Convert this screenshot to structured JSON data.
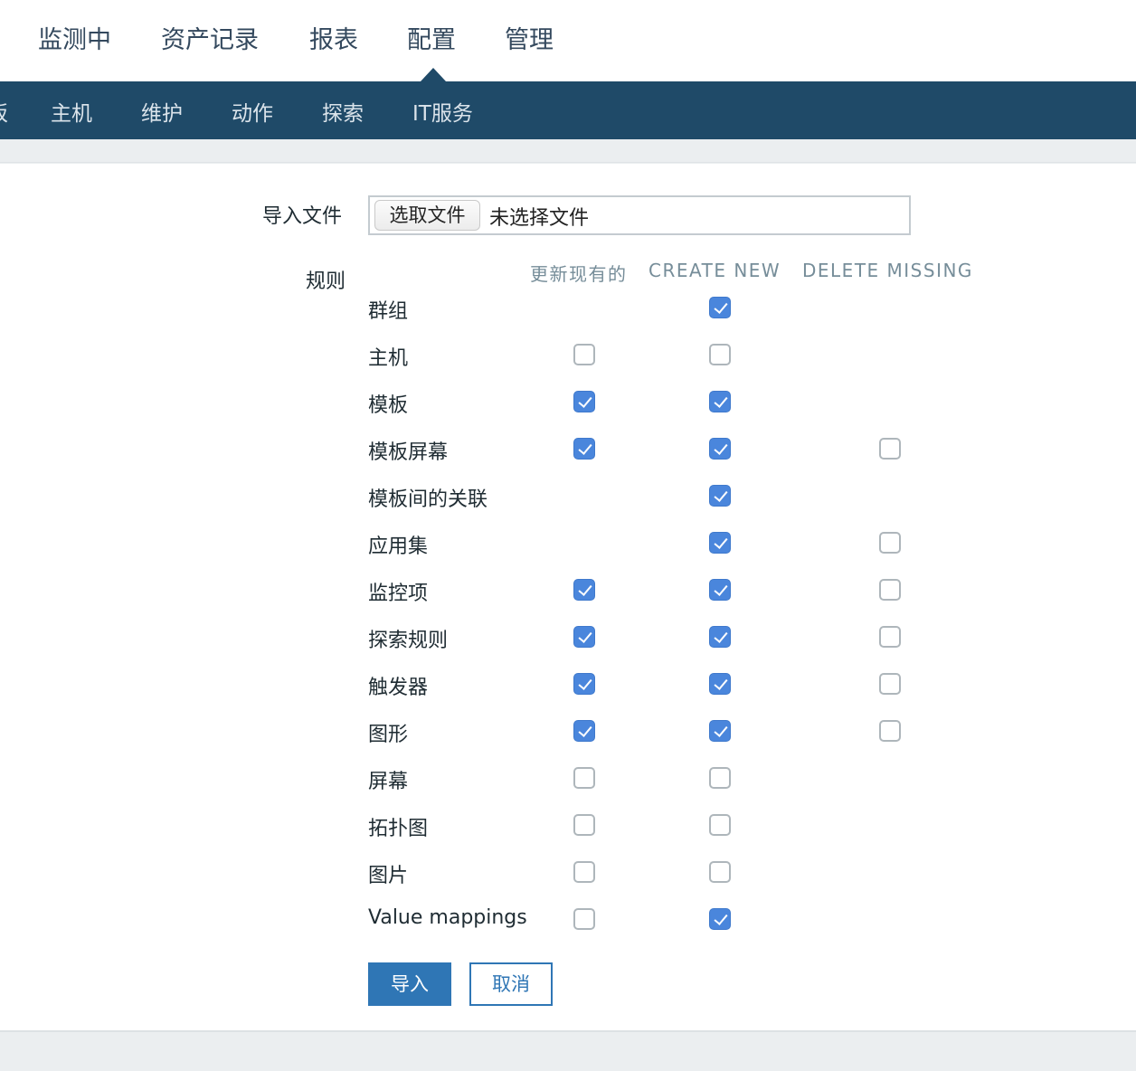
{
  "top_nav": {
    "items": [
      "监测中",
      "资产记录",
      "报表",
      "配置",
      "管理"
    ],
    "active": "配置"
  },
  "sub_nav": {
    "items": [
      "板",
      "主机",
      "维护",
      "动作",
      "探索",
      "IT服务"
    ]
  },
  "form": {
    "import_file_label": "导入文件",
    "choose_file_button": "选取文件",
    "no_file_text": "未选择文件",
    "rules_label": "规则",
    "columns": [
      "更新现有的",
      "CREATE NEW",
      "DELETE MISSING"
    ],
    "rules": [
      {
        "name": "群组",
        "update": null,
        "create": true,
        "delete": null
      },
      {
        "name": "主机",
        "update": false,
        "create": false,
        "delete": null
      },
      {
        "name": "模板",
        "update": true,
        "create": true,
        "delete": null
      },
      {
        "name": "模板屏幕",
        "update": true,
        "create": true,
        "delete": false
      },
      {
        "name": "模板间的关联",
        "update": null,
        "create": true,
        "delete": null
      },
      {
        "name": "应用集",
        "update": null,
        "create": true,
        "delete": false
      },
      {
        "name": "监控项",
        "update": true,
        "create": true,
        "delete": false
      },
      {
        "name": "探索规则",
        "update": true,
        "create": true,
        "delete": false
      },
      {
        "name": "触发器",
        "update": true,
        "create": true,
        "delete": false
      },
      {
        "name": "图形",
        "update": true,
        "create": true,
        "delete": false
      },
      {
        "name": "屏幕",
        "update": false,
        "create": false,
        "delete": null
      },
      {
        "name": "拓扑图",
        "update": false,
        "create": false,
        "delete": null
      },
      {
        "name": "图片",
        "update": false,
        "create": false,
        "delete": null
      },
      {
        "name": "Value mappings",
        "update": false,
        "create": true,
        "delete": null
      }
    ],
    "import_button": "导入",
    "cancel_button": "取消"
  },
  "colors": {
    "subnav_bg": "#1f4a68",
    "primary": "#2f76b5",
    "checkbox_checked": "#4a86dc"
  }
}
